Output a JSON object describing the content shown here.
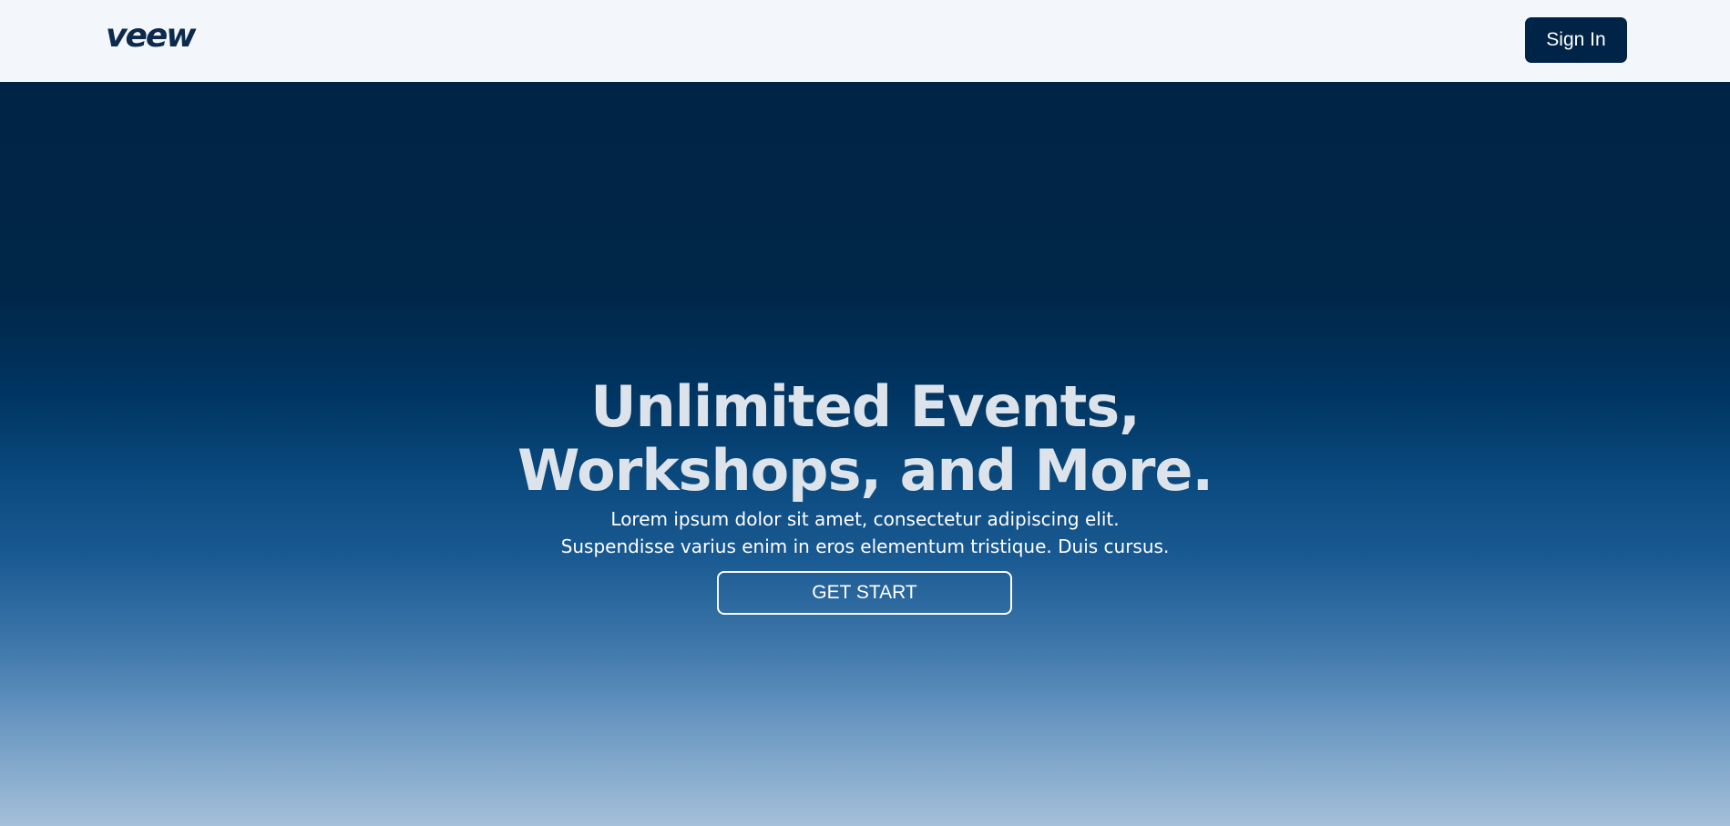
{
  "header": {
    "logo_text": "veew",
    "signin_label": "Sign In"
  },
  "hero": {
    "headline_line1": "Unlimited Events,",
    "headline_line2": "Workshops, and More.",
    "subtext_line1": "Lorem ipsum dolor sit amet, consectetur adipiscing elit.",
    "subtext_line2": "Suspendisse varius enim in eros elementum tristique. Duis cursus.",
    "cta_label": "GET START"
  },
  "colors": {
    "header_bg": "#f3f7fb",
    "brand_navy": "#002447",
    "headline_text": "#dde3ea",
    "gradient_top": "#002445",
    "gradient_bottom": "#a5c0d9"
  }
}
